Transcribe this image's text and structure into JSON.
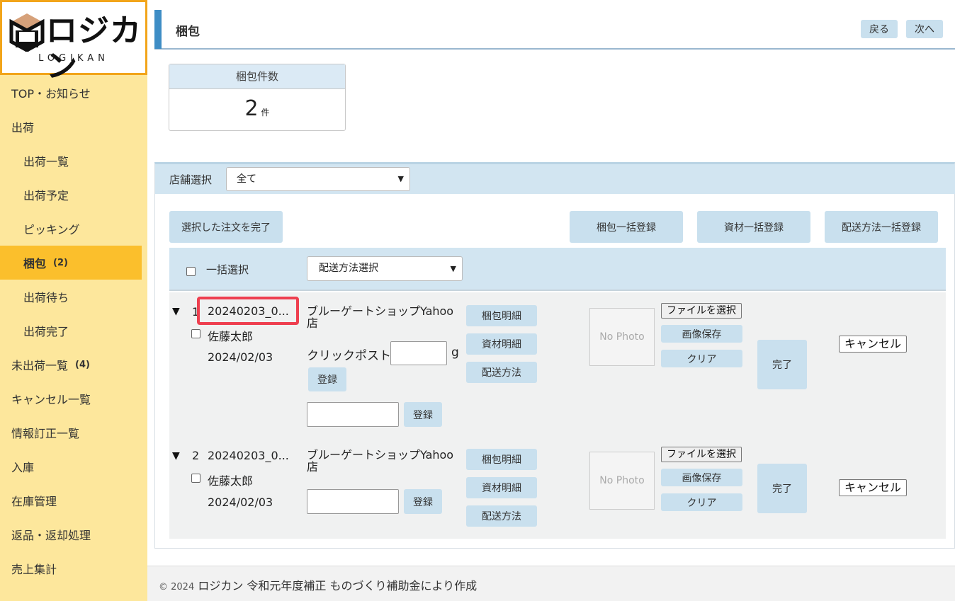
{
  "brand": {
    "logo_text": "ロジカン",
    "logo_sub": "LOGIKAN"
  },
  "sidebar": {
    "items": [
      {
        "label": "TOP・お知らせ"
      },
      {
        "label": "出荷"
      },
      {
        "label": "出荷一覧"
      },
      {
        "label": "出荷予定"
      },
      {
        "label": "ピッキング"
      },
      {
        "label": "梱包",
        "badge": "(2)"
      },
      {
        "label": "出荷待ち"
      },
      {
        "label": "出荷完了"
      },
      {
        "label": "未出荷一覧",
        "badge": "(4)"
      },
      {
        "label": "キャンセル一覧"
      },
      {
        "label": "情報訂正一覧"
      },
      {
        "label": "入庫"
      },
      {
        "label": "在庫管理"
      },
      {
        "label": "返品・返却処理"
      },
      {
        "label": "売上集計"
      }
    ]
  },
  "header": {
    "title": "梱包",
    "back_label": "戻る",
    "next_label": "次へ"
  },
  "summary": {
    "label": "梱包件数",
    "count": "2",
    "unit": "件"
  },
  "filter": {
    "store_label": "店舗選択",
    "store_value": "全て"
  },
  "actions": {
    "complete_selected": "選択した注文を完了",
    "bulk_pack": "梱包一括登録",
    "bulk_material": "資材一括登録",
    "bulk_shipping": "配送方法一括登録"
  },
  "select_bar": {
    "select_all_label": "一括選択",
    "shipping_select_value": "配送方法選択"
  },
  "orders": [
    {
      "index": "1",
      "order_id": "20240203_0...",
      "customer": "佐藤太郎",
      "date": "2024/02/03",
      "shop_line1": "ブルーゲートショップYahoo",
      "shop_line2": "店",
      "shipping_method_label": "クリックポスト",
      "weight_unit": "g",
      "register_label": "登録",
      "pack_detail": "梱包明細",
      "material_detail": "資材明細",
      "shipping_method": "配送方法",
      "no_photo": "No Photo",
      "file_select": "ファイルを選択",
      "save_image": "画像保存",
      "clear": "クリア",
      "complete": "完了",
      "cancel": "キャンセル"
    },
    {
      "index": "2",
      "order_id": "20240203_0...",
      "customer": "佐藤太郎",
      "date": "2024/02/03",
      "shop_line1": "ブルーゲートショップYahoo",
      "shop_line2": "店",
      "register_label": "登録",
      "pack_detail": "梱包明細",
      "material_detail": "資材明細",
      "shipping_method": "配送方法",
      "no_photo": "No Photo",
      "file_select": "ファイルを選択",
      "save_image": "画像保存",
      "clear": "クリア",
      "complete": "完了",
      "cancel": "キャンセル"
    }
  ],
  "footer": {
    "copyright": "© 2024",
    "text": "ロジカン 令和元年度補正 ものづくり補助金により作成"
  }
}
